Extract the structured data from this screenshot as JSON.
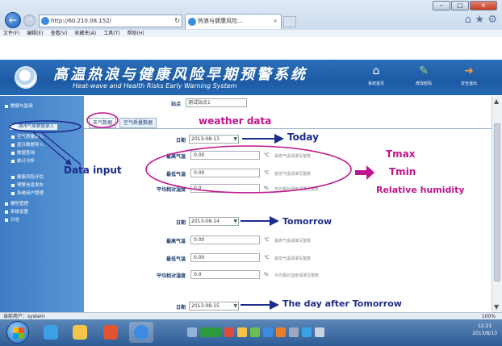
{
  "browser": {
    "address": "http://60.210.08.152/",
    "tab_label": "热浪与健康风险...",
    "tab_close": "×",
    "menu": [
      "文件(F)",
      "编辑(E)",
      "查看(V)",
      "收藏夹(A)",
      "工具(T)",
      "帮助(H)"
    ],
    "window_buttons": [
      "–",
      "□",
      "×"
    ]
  },
  "app": {
    "title": "高温热浪与健康风险早期预警系统",
    "subtitle": "Heat-wave and Health Risks Early Warning System",
    "header_buttons": [
      {
        "label": "系统首页",
        "icon": "home-icon"
      },
      {
        "label": "修改密码",
        "icon": "password-icon"
      },
      {
        "label": "安全退出",
        "icon": "exit-icon"
      }
    ]
  },
  "sidebar": {
    "items": [
      {
        "label": "数据与监测",
        "level": 1
      },
      {
        "label": "城市气象数据录入",
        "level": 2,
        "active": true
      },
      {
        "label": "空气质量录入",
        "level": 2
      },
      {
        "label": "逐日数据导入",
        "level": 2
      },
      {
        "label": "数据查询",
        "level": 2
      },
      {
        "label": "统计分析",
        "level": 2
      },
      {
        "label": "健康风险评估",
        "level": 2
      },
      {
        "label": "预警信息发布",
        "level": 2
      },
      {
        "label": "系统用户管理",
        "level": 2
      },
      {
        "label": "模型管理",
        "level": 1
      },
      {
        "label": "系统设置",
        "level": 1
      },
      {
        "label": "日志",
        "level": 1
      }
    ]
  },
  "form": {
    "station_label": "站点",
    "station_value": "测试站点1",
    "tabs": [
      "天气数据",
      "空气质量数据"
    ],
    "date_label": "日期",
    "tmax_label": "最高气温",
    "tmin_label": "最低气温",
    "rh_label": "平均相对湿度",
    "days": [
      {
        "date": "2013-08-13",
        "tmax": "0.00",
        "tmin": "0.00",
        "rh": "0.0"
      },
      {
        "date": "2013-08-14",
        "tmax": "0.00",
        "tmin": "0.00",
        "rh": "0.0"
      },
      {
        "date": "2013-08-15"
      }
    ],
    "unit_temp": "℃",
    "unit_rh": "%",
    "hint_tmax": "最高气温请填写整数",
    "hint_tmin": "最低气温请填写整数",
    "hint_rh": "平均相对湿度请填写整数"
  },
  "annotations": {
    "weather_data": "weather data",
    "today": "Today",
    "tmax": "Tmax",
    "tmin": "Tmin",
    "relative_humidity": "Relative humidity",
    "data_input": "Data input",
    "tomorrow": "Tomorrow",
    "day_after": "The day after Tomorrow"
  },
  "statusbar": {
    "user": "当前用户：system",
    "zoom": "100%"
  },
  "taskbar": {
    "time": "12:21",
    "date": "2013/8/13"
  },
  "colors": {
    "header_blue": "#1d5aa3",
    "annotation_magenta": "#c0168d",
    "annotation_navy": "#1c2c8c"
  }
}
